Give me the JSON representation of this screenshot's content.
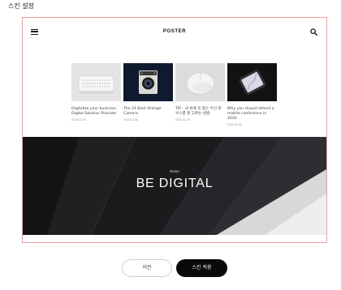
{
  "dialog": {
    "title": "스킨 설정"
  },
  "preview": {
    "logo": "POSTER",
    "menu_icon": "hamburger-icon",
    "search_icon": "search-icon",
    "cards": [
      {
        "title": "Digitalize your business: Digital Solution Provider",
        "date": "2020.02.06"
      },
      {
        "title": "The 24 Best Vintage Camera",
        "date": "2020.02.06"
      },
      {
        "title": "TIP - 내 손에 꼭 맞는 무선 마우스를 잘 고르는 방법",
        "date": "2020.02.06"
      },
      {
        "title": "Why you should attend a mobile conference in 2020",
        "date": "2020.02.06"
      }
    ],
    "hero": {
      "kicker": "Better",
      "title": "BE DIGITAL"
    }
  },
  "footer": {
    "back_label": "이전",
    "apply_label": "스킨 적용"
  },
  "colors": {
    "frame_border": "#ea9d9d",
    "hero_bg": "#1c1c1e",
    "apply_bg": "#0a0a0a"
  }
}
